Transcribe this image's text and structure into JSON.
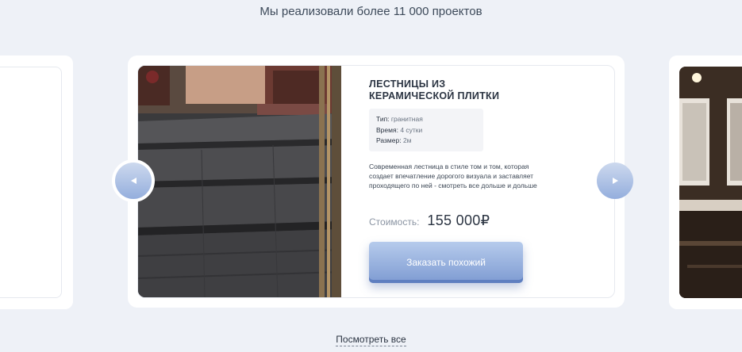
{
  "section": {
    "heading": "Мы реализовали более 11 000 проектов",
    "see_all_label": "Посмотреть все"
  },
  "card": {
    "title": "ЛЕСТНИЦЫ ИЗ КЕРАМИЧЕСКОЙ ПЛИТКИ",
    "specs": [
      {
        "key": "Тип:",
        "value": "гранитная"
      },
      {
        "key": "Время:",
        "value": "4 сутки"
      },
      {
        "key": "Размер:",
        "value": "2м"
      }
    ],
    "description": "Современная лестница в стиле том и том, которая создает впечатление дорогого визуала и заставляет проходящего по ней - смотреть все дольше и дольше",
    "price_label": "Стоимость:",
    "price_value": "155 000₽",
    "order_button_label": "Заказать похожий"
  },
  "icons": {
    "prev": "arrow-left-icon",
    "next": "arrow-right-icon"
  },
  "colors": {
    "background": "#eef1f7",
    "accent": "#7e9bd2",
    "text": "#2b3442"
  }
}
